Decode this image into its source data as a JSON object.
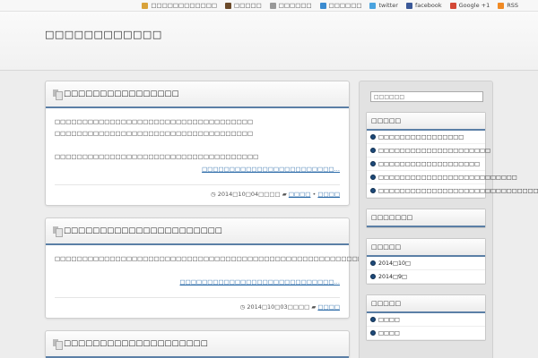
{
  "topbar": {
    "links": [
      {
        "label": "□□□□□□□□□□□□",
        "icon": "edit-icon",
        "color": "#d9a23a"
      },
      {
        "label": "□□□□□",
        "icon": "download-icon",
        "color": "#6b4a2a"
      },
      {
        "label": "□□□□□□",
        "icon": "mail-icon",
        "color": "#999999"
      },
      {
        "label": "□□□□□□",
        "icon": "hatena-icon",
        "color": "#3b8bd0"
      },
      {
        "label": "twitter",
        "icon": "twitter-icon",
        "color": "#4aa3df"
      },
      {
        "label": "facebook",
        "icon": "facebook-icon",
        "color": "#3b5998"
      },
      {
        "label": "Google +1",
        "icon": "google-plus-icon",
        "color": "#d34836"
      },
      {
        "label": "RSS",
        "icon": "rss-icon",
        "color": "#f08a24"
      }
    ]
  },
  "header": {
    "title": "□□□□□□□□□□□□"
  },
  "posts": [
    {
      "title": "□□□□□□□□□□□□□□□□",
      "lines": [
        "□□□□□□□□□□□□□□□□□□□□□□□□□□□□□□□□□□□□",
        "□□□□□□□□□□□□□□□□□□□□□□□□□□□□□□□□□□□□"
      ],
      "extra": "□□□□□□□□□□□□□□□□□□□□□□□□□□□□□□□□□□□□□",
      "more": "□□□□□□□□□□□□□□□□□□□□□□□□…",
      "date": "2014□10□04□□□□",
      "cats": [
        "□□□□",
        "□□□□"
      ]
    },
    {
      "title": "□□□□□□□□□□□□□□□□□□□□□□",
      "lines": [
        "□□□□□□□□□□□□□□□□□□□□□□□□□□□□□□□□□□□□□□□□□□□□□□□□□□□□□□□□□□□"
      ],
      "extra": "",
      "more": "□□□□□□□□□□□□□□□□□□□□□□□□□□□□…",
      "date": "2014□10□03□□□□",
      "cats": [
        "□□□□"
      ]
    },
    {
      "title": "□□□□□□□□□□□□□□□□□□□□"
    }
  ],
  "sidebar": {
    "search_value": "□□□□□□",
    "widgets": [
      {
        "title": "□□□□□",
        "items": [
          "□□□□□□□□□□□□□□□□",
          "□□□□□□□□□□□□□□□□□□□□□",
          "□□□□□□□□□□□□□□□□□□□",
          "□□□□□□□□□□□□□□□□□□□□□□□□□□",
          "□□□□□□□□□□□□□□□□□□□□□□□□□□□□□□□□□"
        ]
      },
      {
        "title": "□□□□□□□",
        "items": []
      },
      {
        "title": "□□□□□",
        "items": [
          "2014□10□",
          "2014□9□"
        ]
      },
      {
        "title": "□□□□□",
        "items": [
          "□□□□",
          "□□□□"
        ]
      }
    ]
  }
}
